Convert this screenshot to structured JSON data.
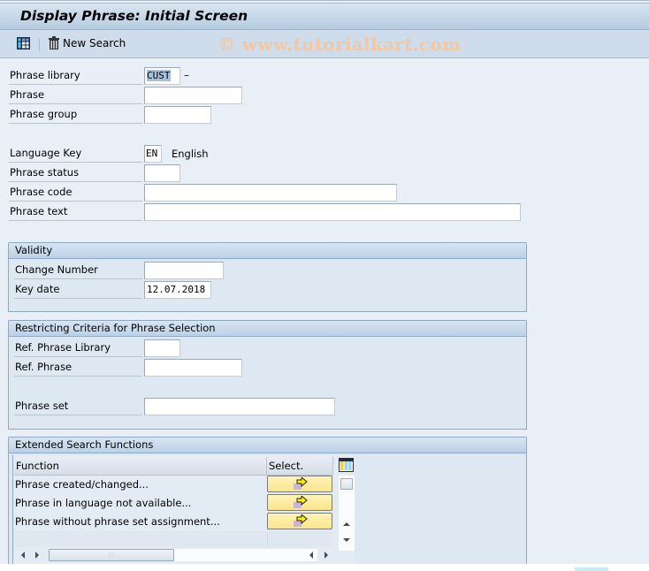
{
  "window": {
    "title": "Display Phrase: Initial Screen"
  },
  "toolbar": {
    "layout_icon": "grid-layout-icon",
    "new_search_icon": "trash-icon",
    "new_search_label": "New Search",
    "watermark": "© www.tutorialkart.com"
  },
  "form": {
    "phrase_library": {
      "label": "Phrase library",
      "value": "CUST",
      "suffix": "–"
    },
    "phrase": {
      "label": "Phrase",
      "value": ""
    },
    "phrase_group": {
      "label": "Phrase group",
      "value": ""
    },
    "language_key": {
      "label": "Language Key",
      "value": "EN",
      "description": "English"
    },
    "phrase_status": {
      "label": "Phrase status",
      "value": ""
    },
    "phrase_code": {
      "label": "Phrase code",
      "value": ""
    },
    "phrase_text": {
      "label": "Phrase text",
      "value": ""
    }
  },
  "validity": {
    "title": "Validity",
    "change_number": {
      "label": "Change Number",
      "value": ""
    },
    "key_date": {
      "label": "Key date",
      "value": "12.07.2018"
    }
  },
  "restricting": {
    "title": "Restricting Criteria for Phrase Selection",
    "ref_phrase_library": {
      "label": "Ref. Phrase Library",
      "value": ""
    },
    "ref_phrase": {
      "label": "Ref. Phrase",
      "value": ""
    },
    "phrase_set": {
      "label": "Phrase set",
      "value": ""
    }
  },
  "extended": {
    "title": "Extended Search Functions",
    "columns": [
      "Function",
      "Select."
    ],
    "column_config_icon": "column-layout-icon",
    "rows": [
      {
        "function": "Phrase created/changed...",
        "select_icon": "execute-arrow-icon"
      },
      {
        "function": "Phrase in language not available...",
        "select_icon": "execute-arrow-icon"
      },
      {
        "function": "Phrase without phrase set assignment...",
        "select_icon": "execute-arrow-icon"
      }
    ]
  },
  "colors": {
    "background": "#e8eff7",
    "title_gradient_top": "#d9e5f1",
    "title_gradient_bottom": "#b5cbe0",
    "toolbar": "#cedceb",
    "group_border": "#8ea9c6",
    "select_button": "#fbe58a",
    "watermark": "#f2c7a1",
    "selection_highlight": "#a6c0dc"
  }
}
